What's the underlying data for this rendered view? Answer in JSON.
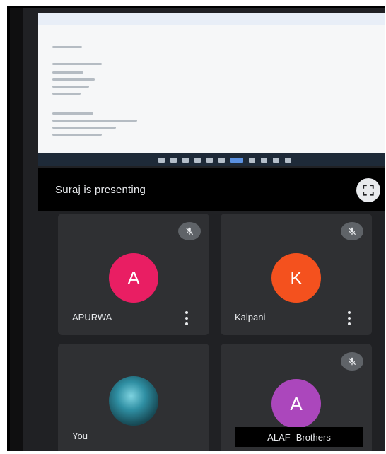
{
  "presenting": {
    "text": "Suraj is presenting"
  },
  "participants": [
    {
      "name": "APURWA",
      "initial": "A",
      "avatar_color": "#e91e63"
    },
    {
      "name": "Kalpani",
      "initial": "K",
      "avatar_color": "#f4511e"
    },
    {
      "name": "You",
      "initial": "",
      "avatar_color": "#2f8fa3"
    },
    {
      "name": "",
      "initial": "A",
      "avatar_color": "#ab47bc"
    }
  ],
  "bottom_caption": {
    "left": "ALAF",
    "right": "Brothers"
  },
  "icons": {
    "mic_muted": "mic-off-icon",
    "expand": "fullscreen-icon",
    "more": "more-vert-icon"
  }
}
